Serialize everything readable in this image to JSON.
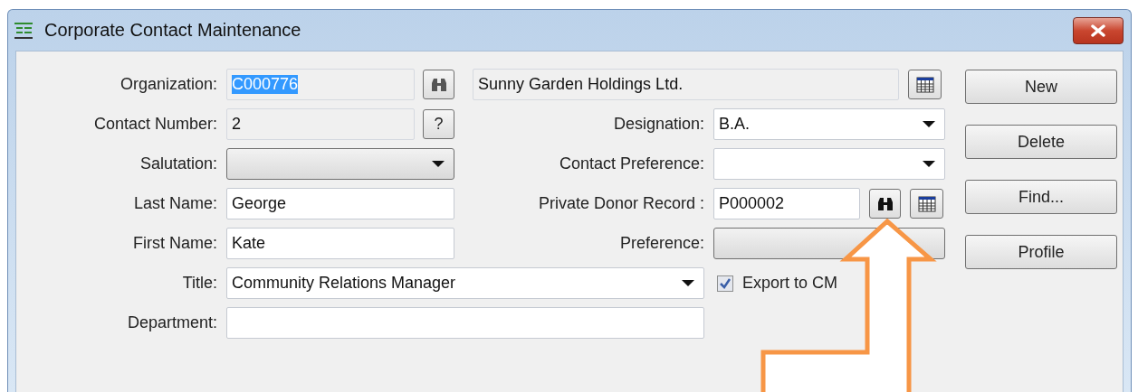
{
  "window": {
    "title": "Corporate Contact Maintenance"
  },
  "organization": {
    "label": "Organization:",
    "value": "C000776",
    "text_selected": true
  },
  "organization_name": {
    "value": "Sunny Garden Holdings Ltd."
  },
  "contact_number": {
    "label": "Contact Number:",
    "value": "2",
    "help_button": "?"
  },
  "designation": {
    "label": "Designation:",
    "value": "B.A."
  },
  "salutation": {
    "label": "Salutation:"
  },
  "contact_preference": {
    "label": "Contact Preference:"
  },
  "last_name": {
    "label": "Last Name:",
    "value": "George"
  },
  "private_donor_record": {
    "label": "Private Donor Record :",
    "value": "P000002"
  },
  "first_name": {
    "label": "First Name:",
    "value": "Kate"
  },
  "preference": {
    "label": "Preference:"
  },
  "title": {
    "label": "Title:",
    "value": "Community Relations Manager"
  },
  "export_to_cms": {
    "label": "Export to CM",
    "checked": true
  },
  "department": {
    "label": "Department:"
  },
  "buttons": [
    "New",
    "Delete",
    "Find...",
    "Profile"
  ]
}
